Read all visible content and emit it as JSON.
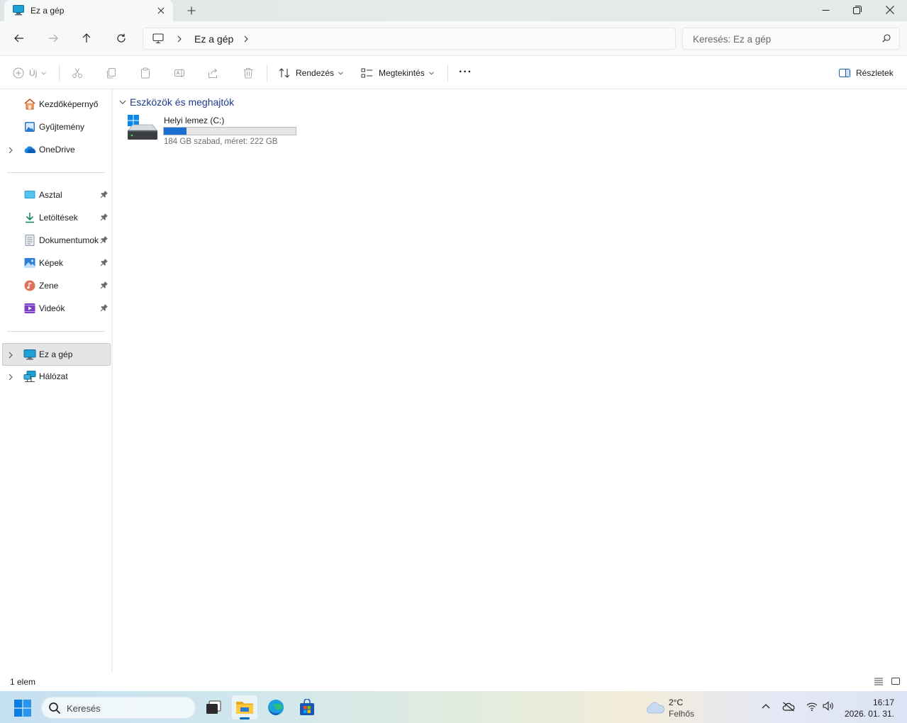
{
  "window": {
    "tab_title": "Ez a gép",
    "new_tab": "+"
  },
  "navigation": {
    "breadcrumb": [
      "Ez a gép"
    ],
    "search_placeholder": "Keresés: Ez a gép"
  },
  "commands": {
    "new_label": "Új",
    "sort_label": "Rendezés",
    "view_label": "Megtekintés",
    "more_label": "···",
    "details_label": "Részletek"
  },
  "sidebar": {
    "top": [
      {
        "label": "Kezdőképernyő",
        "icon": "home-icon"
      },
      {
        "label": "Gyűjtemény",
        "icon": "gallery-icon"
      },
      {
        "label": "OneDrive",
        "icon": "onedrive-icon"
      }
    ],
    "pinned": [
      {
        "label": "Asztal",
        "icon": "desktop-icon"
      },
      {
        "label": "Letöltések",
        "icon": "download-icon"
      },
      {
        "label": "Dokumentumok",
        "icon": "documents-icon"
      },
      {
        "label": "Képek",
        "icon": "pictures-icon"
      },
      {
        "label": "Zene",
        "icon": "music-icon"
      },
      {
        "label": "Videók",
        "icon": "videos-icon"
      }
    ],
    "bottom": [
      {
        "label": "Ez a gép",
        "icon": "pc-icon"
      },
      {
        "label": "Hálózat",
        "icon": "network-icon"
      }
    ]
  },
  "main": {
    "group_title": "Eszközök és meghajtók",
    "drives": [
      {
        "name": "Helyi lemez (C:)",
        "subtitle": "184 GB szabad, méret: 222 GB",
        "used_fraction": 0.171
      }
    ]
  },
  "status": {
    "item_count": "1 elem"
  },
  "taskbar": {
    "search_label": "Keresés",
    "weather_temp": "2°C",
    "weather_desc": "Felhős",
    "time": "16:17",
    "date": "2026. 01. 31."
  },
  "colors": {
    "accent": "#0067c0",
    "drive_bar": "#1a6fd1",
    "group_title": "#1f3b8a"
  }
}
